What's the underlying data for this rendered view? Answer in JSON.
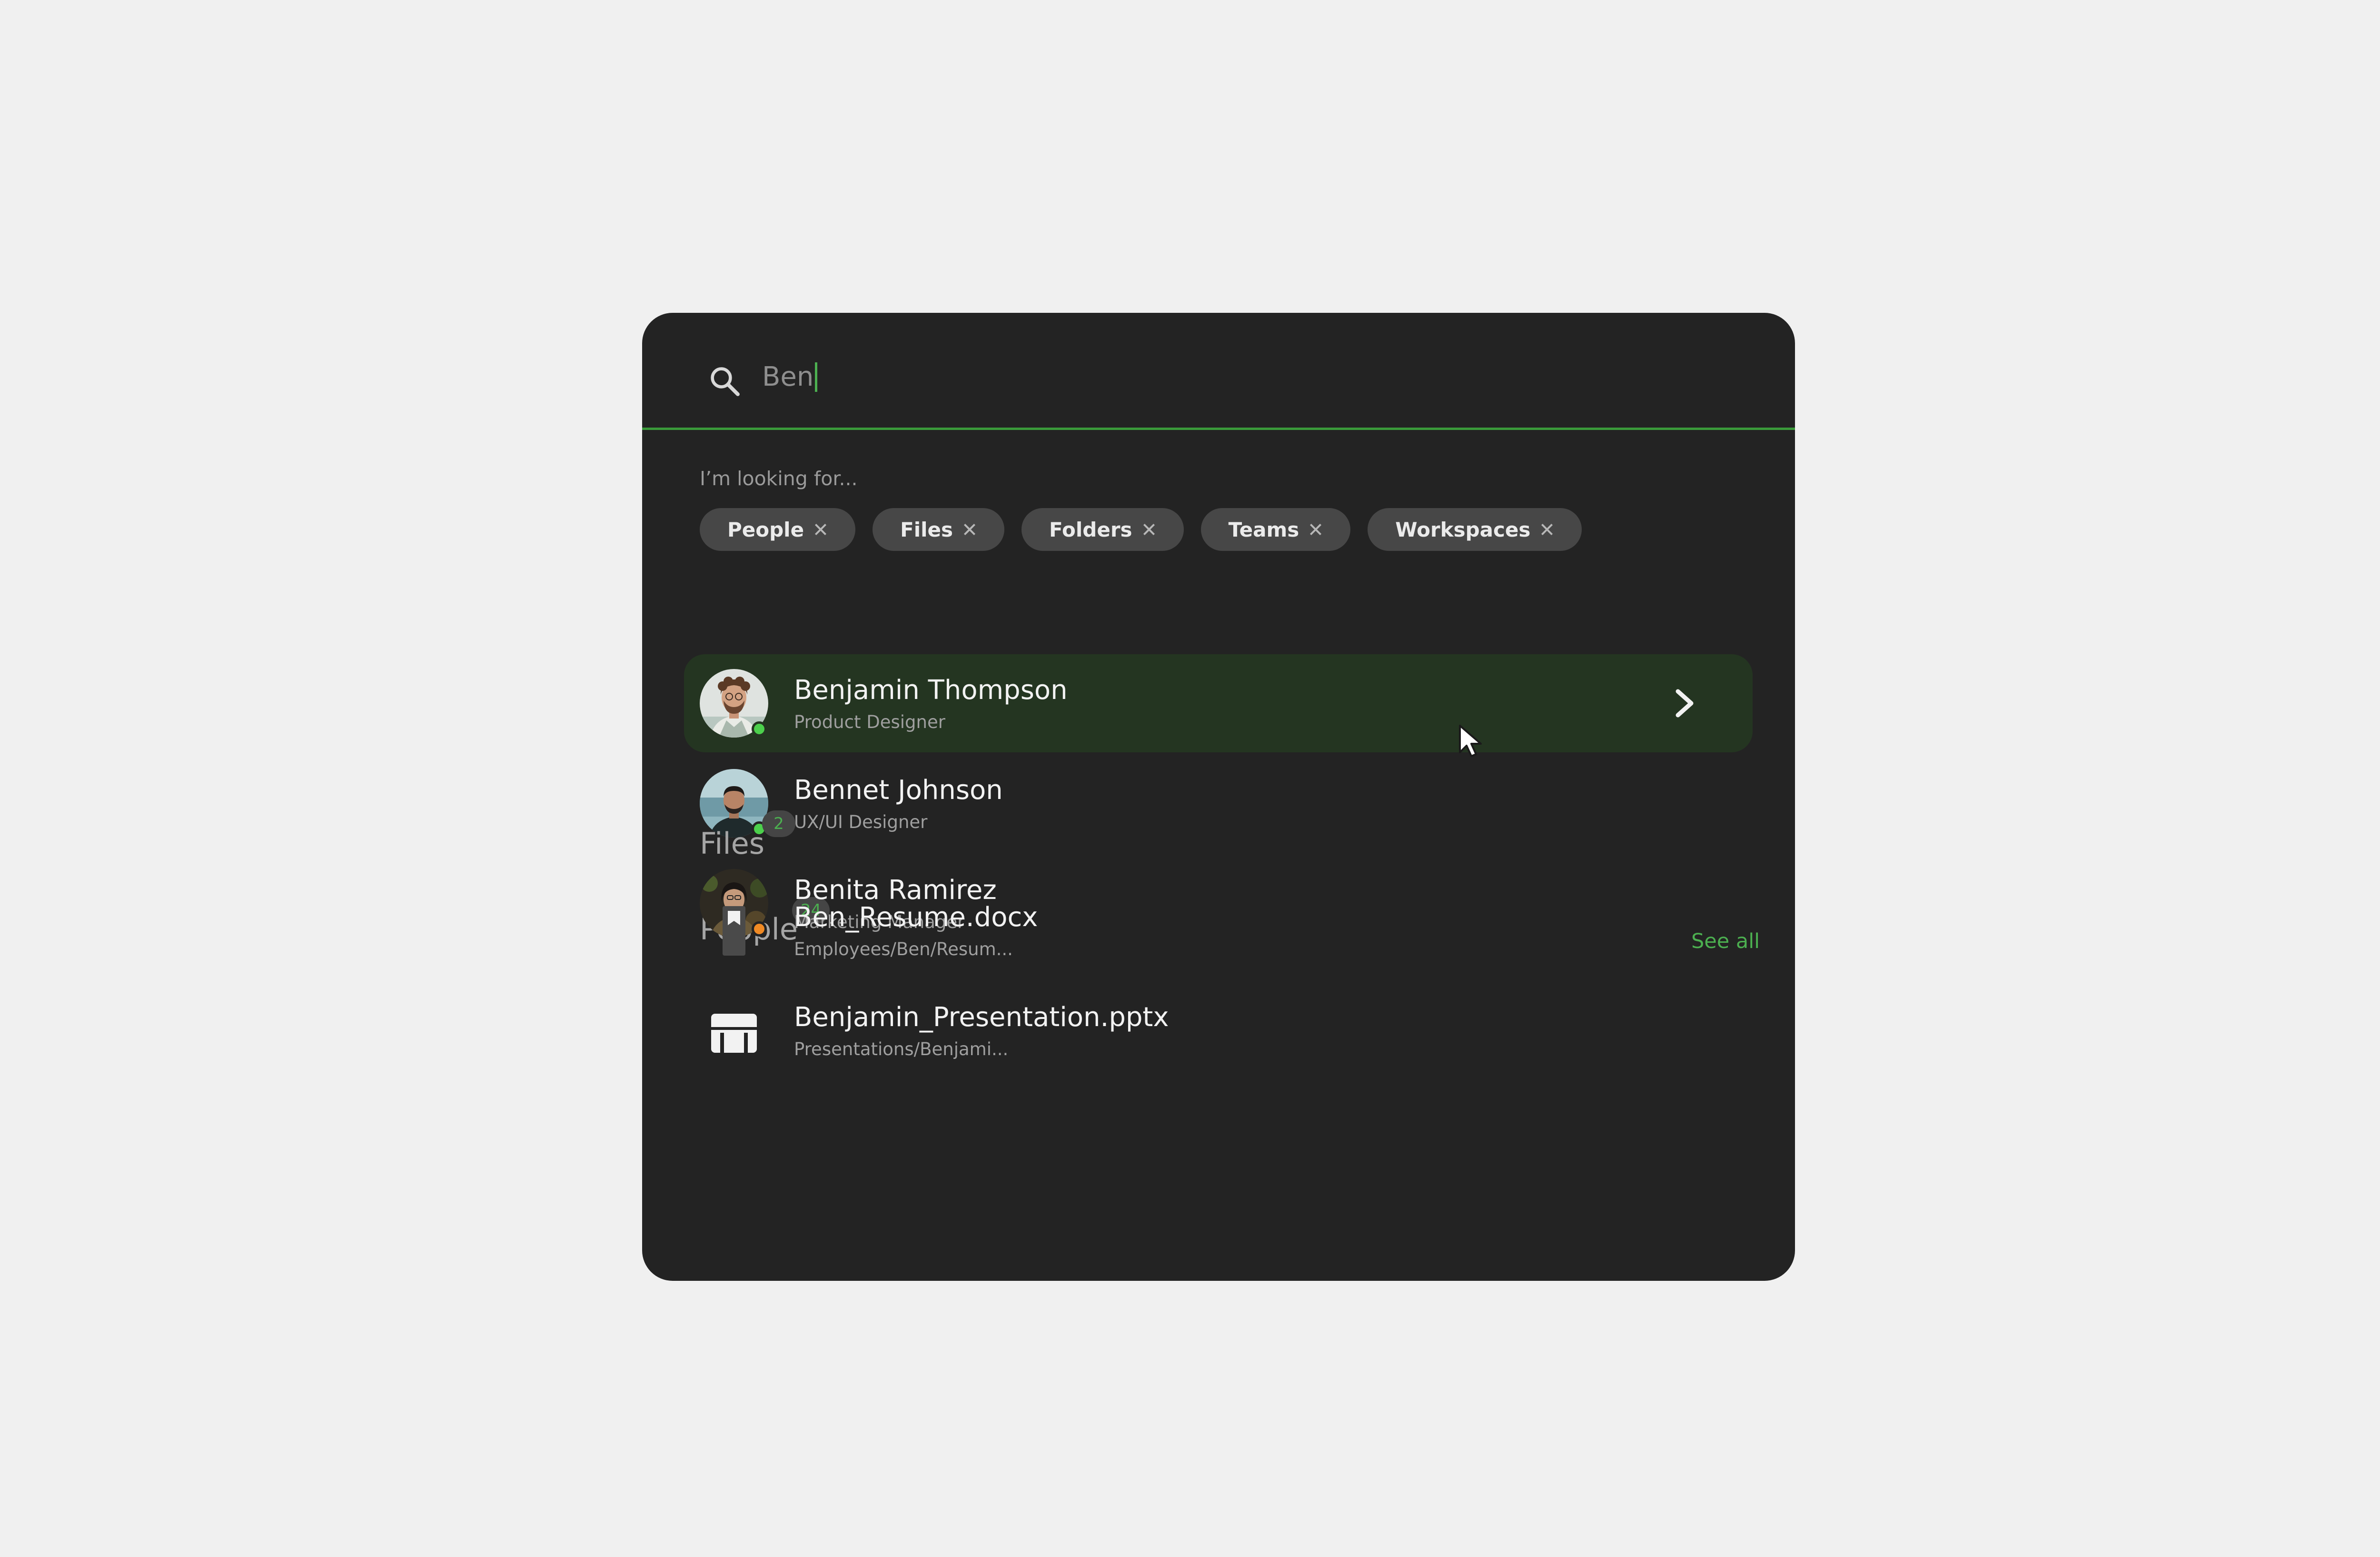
{
  "search": {
    "value": "Ben"
  },
  "filters": {
    "label": "I’m looking for...",
    "chips": [
      {
        "label": "People"
      },
      {
        "label": "Files"
      },
      {
        "label": "Folders"
      },
      {
        "label": "Teams"
      },
      {
        "label": "Workspaces"
      }
    ]
  },
  "people_section": {
    "title": "People",
    "count": "24",
    "see_all": "See all",
    "items": [
      {
        "name": "Benjamin Thompson",
        "role": "Product Designer",
        "status": "online",
        "status_color": "#4cd04c",
        "selected": true
      },
      {
        "name": "Bennet Johnson",
        "role": "UX/UI Designer",
        "status": "online",
        "status_color": "#4cd04c",
        "selected": false
      },
      {
        "name": "Benita Ramirez",
        "role": "Marketing Manager",
        "status": "away",
        "status_color": "#f08a24",
        "selected": false
      }
    ]
  },
  "files_section": {
    "title": "Files",
    "count": "2",
    "items": [
      {
        "name": "Ben_Resume.docx",
        "path": "Employees/Ben/Resum...",
        "icon": "document-icon"
      },
      {
        "name": "Benjamin_Presentation.pptx",
        "path": "Presentations/Benjami...",
        "icon": "presentation-icon"
      }
    ]
  },
  "colors": {
    "accent": "#4caf50",
    "panel": "#232323",
    "selected_row": "#243521",
    "background": "#f0f0f0"
  }
}
